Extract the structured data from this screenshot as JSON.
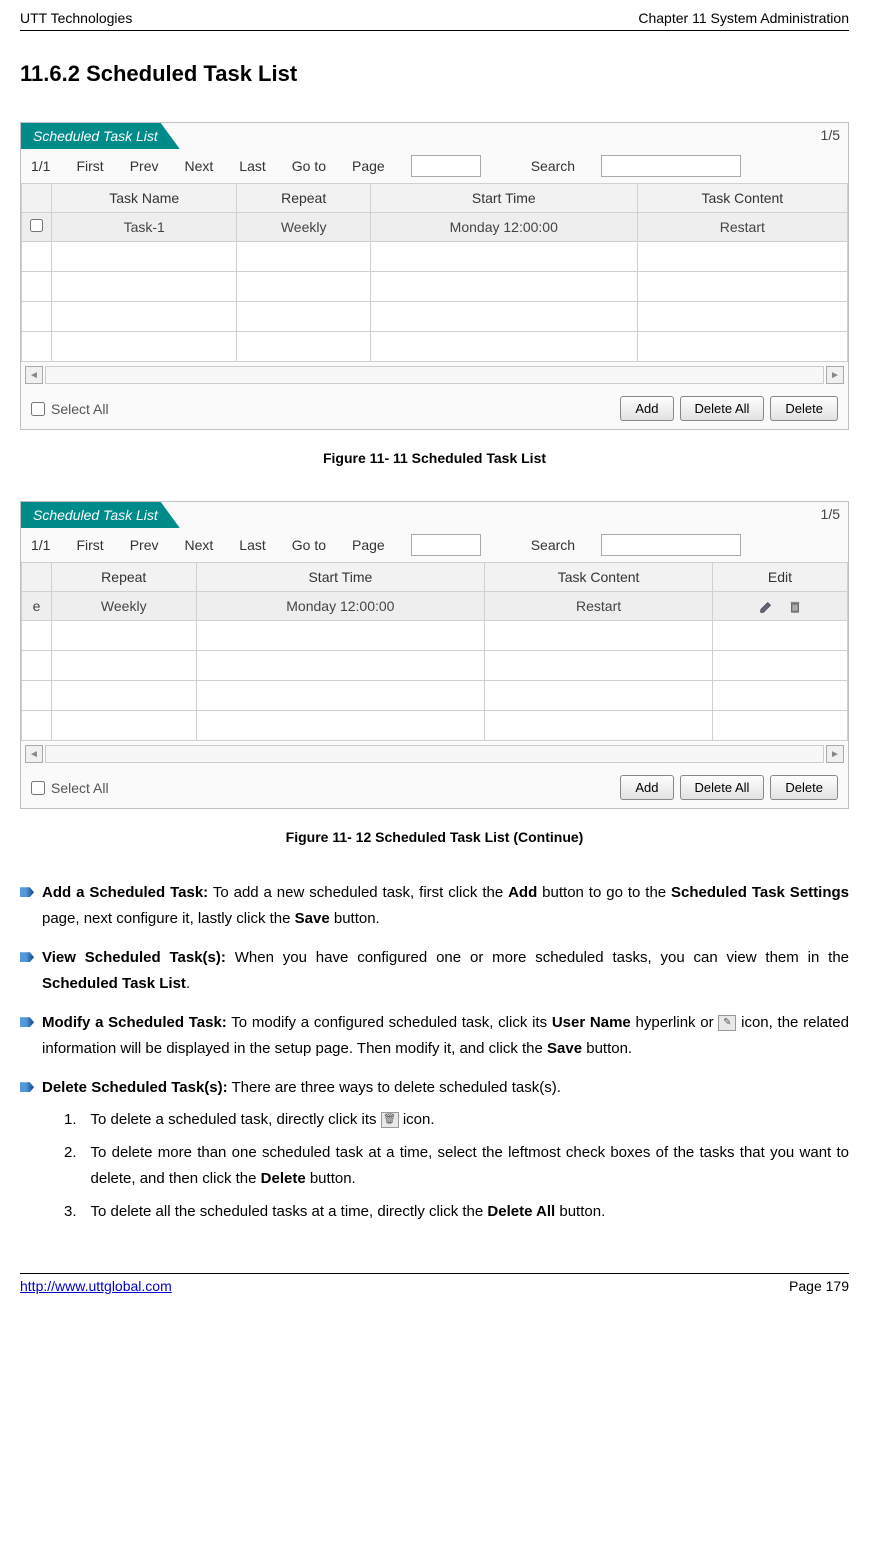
{
  "header": {
    "left": "UTT Technologies",
    "right": "Chapter 11 System Administration"
  },
  "section_heading": "11.6.2  Scheduled Task List",
  "panel1": {
    "tab_title": "Scheduled Task List",
    "page_indicator": "1/5",
    "toolbar": {
      "counter": "1/1",
      "first": "First",
      "prev": "Prev",
      "next": "Next",
      "last": "Last",
      "goto": "Go to",
      "page": "Page",
      "search": "Search"
    },
    "columns": [
      "",
      "Task Name",
      "Repeat",
      "Start Time",
      "Task Content"
    ],
    "row": {
      "name": "Task-1",
      "repeat": "Weekly",
      "start": "Monday 12:00:00",
      "content": "Restart"
    },
    "select_all": "Select All",
    "buttons": {
      "add": "Add",
      "delete_all": "Delete All",
      "delete": "Delete"
    }
  },
  "caption1": "Figure 11- 11 Scheduled Task List",
  "panel2": {
    "tab_title": "Scheduled Task List",
    "page_indicator": "1/5",
    "toolbar": {
      "counter": "1/1",
      "first": "First",
      "prev": "Prev",
      "next": "Next",
      "last": "Last",
      "goto": "Go to",
      "page": "Page",
      "search": "Search"
    },
    "columns": [
      "",
      "Repeat",
      "Start Time",
      "Task Content",
      "Edit"
    ],
    "row": {
      "col0": "e",
      "repeat": "Weekly",
      "start": "Monday 12:00:00",
      "content": "Restart"
    },
    "select_all": "Select All",
    "buttons": {
      "add": "Add",
      "delete_all": "Delete All",
      "delete": "Delete"
    }
  },
  "caption2": "Figure 11- 12 Scheduled Task List (Continue)",
  "items": {
    "add": {
      "bold1": "Add a Scheduled Task:",
      "text1": " To add a new scheduled task, first click the ",
      "bold2": "Add",
      "text2": " button to go to the ",
      "bold3": "Scheduled Task Settings",
      "text3": " page, next configure it, lastly click the ",
      "bold4": "Save",
      "text4": " button."
    },
    "view": {
      "bold1": "View Scheduled Task(s):",
      "text1": " When you have configured one or more scheduled tasks, you can view them in the ",
      "bold2": "Scheduled Task List",
      "text2": "."
    },
    "modify": {
      "bold1": "Modify a Scheduled Task:",
      "text1": " To modify a configured scheduled task, click its ",
      "bold2": "User Name",
      "text2": " hyperlink or ",
      "text3": " icon, the related information will be displayed in the setup page. Then modify it, and click the ",
      "bold3": "Save",
      "text4": " button."
    },
    "delete": {
      "bold1": "Delete Scheduled Task(s):",
      "text1": " There are three ways to delete scheduled task(s).",
      "n1": "1.",
      "n1_text1": "To delete a scheduled task, directly click its ",
      "n1_text2": " icon.",
      "n2": "2.",
      "n2_text1": "To delete more than one scheduled task at a time, select the leftmost check boxes of the tasks that you want to delete, and then click the ",
      "n2_bold": "Delete",
      "n2_text2": " button.",
      "n3": "3.",
      "n3_text1": "To delete all the scheduled tasks at a time, directly click the ",
      "n3_bold": "Delete All",
      "n3_text2": " button."
    }
  },
  "footer": {
    "url": "http://www.uttglobal.com",
    "page": "Page 179"
  }
}
